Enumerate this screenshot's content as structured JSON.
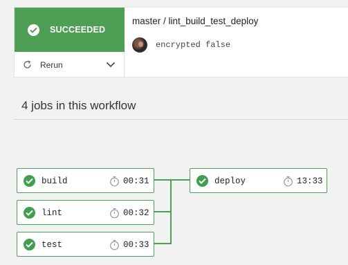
{
  "workflow": {
    "status": "SUCCEEDED",
    "rerun_label": "Rerun",
    "title": "master / lint_build_test_deploy",
    "commit_message": "encrypted false"
  },
  "jobs_heading": "4 jobs in this workflow",
  "jobs": [
    {
      "name": "build",
      "duration": "00:31"
    },
    {
      "name": "lint",
      "duration": "00:32"
    },
    {
      "name": "test",
      "duration": "00:33"
    },
    {
      "name": "deploy",
      "duration": "13:33"
    }
  ],
  "colors": {
    "success": "#4f9e55",
    "background": "#f2f2f2"
  },
  "icons": {
    "status": "check-circle-icon",
    "rerun": "rerun-icon",
    "dropdown": "chevron-down-icon",
    "duration": "stopwatch-icon"
  }
}
